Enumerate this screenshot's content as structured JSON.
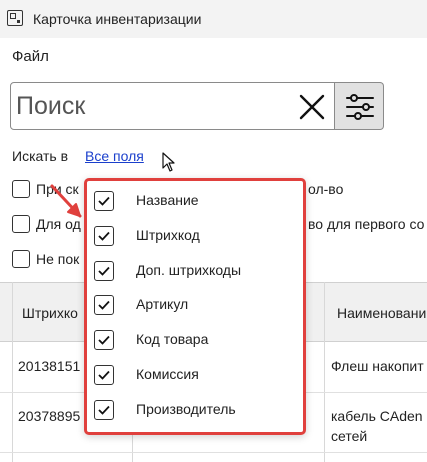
{
  "window": {
    "title": "Карточка инвентаризации"
  },
  "menu": {
    "file": "Файл"
  },
  "search": {
    "placeholder": "Поиск"
  },
  "search_in": {
    "label": "Искать в",
    "link": "Все поля"
  },
  "checkboxes": [
    {
      "left": "При ск",
      "right": "ол-во"
    },
    {
      "left": "Для од",
      "right": "во для первого со"
    },
    {
      "left": "Не пок",
      "right": ""
    }
  ],
  "table": {
    "headers": [
      "Штрихко",
      "",
      "Наименовани"
    ],
    "rows": [
      {
        "barcode": "20138151",
        "name_line1": "Флеш накопит",
        "name_line2": ""
      },
      {
        "barcode": "20378895",
        "name_line1": "кабель CAden",
        "name_line2": "сетей"
      }
    ]
  },
  "fields_popup": {
    "items": [
      {
        "label": "Название",
        "checked": true
      },
      {
        "label": "Штрихкод",
        "checked": true
      },
      {
        "label": "Доп. штрихкоды",
        "checked": true
      },
      {
        "label": "Артикул",
        "checked": true
      },
      {
        "label": "Код товара",
        "checked": true
      },
      {
        "label": "Комиссия",
        "checked": true
      },
      {
        "label": "Производитель",
        "checked": true
      }
    ]
  },
  "colors": {
    "highlight": "#e0403d",
    "link": "#1a3fcc"
  }
}
